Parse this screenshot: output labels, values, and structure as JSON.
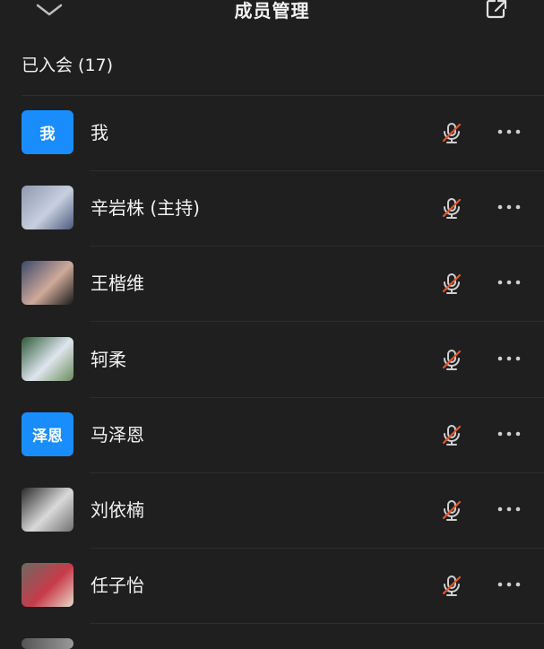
{
  "header": {
    "title": "成员管理",
    "back_icon": "chevron-down-icon",
    "share_icon": "external-share-icon"
  },
  "section": {
    "label": "已入会 (17)"
  },
  "members": [
    {
      "name": "我",
      "avatar_text": "我",
      "avatar_type": "text"
    },
    {
      "name": "辛岩株 (主持)",
      "avatar_type": "photo",
      "avatar_colors": [
        "#8f98b0",
        "#c7cfdf",
        "#4c5a7d"
      ]
    },
    {
      "name": "王楷维",
      "avatar_type": "photo",
      "avatar_colors": [
        "#3a4a6a",
        "#cfa99a",
        "#1a1a1a"
      ]
    },
    {
      "name": "轲柔",
      "avatar_type": "photo",
      "avatar_colors": [
        "#2d5a3a",
        "#dfe5ee",
        "#6b8c5a"
      ]
    },
    {
      "name": "马泽恩",
      "avatar_text": "泽恩",
      "avatar_type": "text"
    },
    {
      "name": "刘依楠",
      "avatar_type": "photo",
      "avatar_colors": [
        "#2a2a2a",
        "#d9d9d9",
        "#707070"
      ]
    },
    {
      "name": "任子怡",
      "avatar_type": "photo",
      "avatar_colors": [
        "#6d6b62",
        "#c83a4a",
        "#e8d9c8"
      ]
    }
  ],
  "colors": {
    "accent": "#1a8dfc",
    "mic_muted_slash": "#e0572f"
  }
}
